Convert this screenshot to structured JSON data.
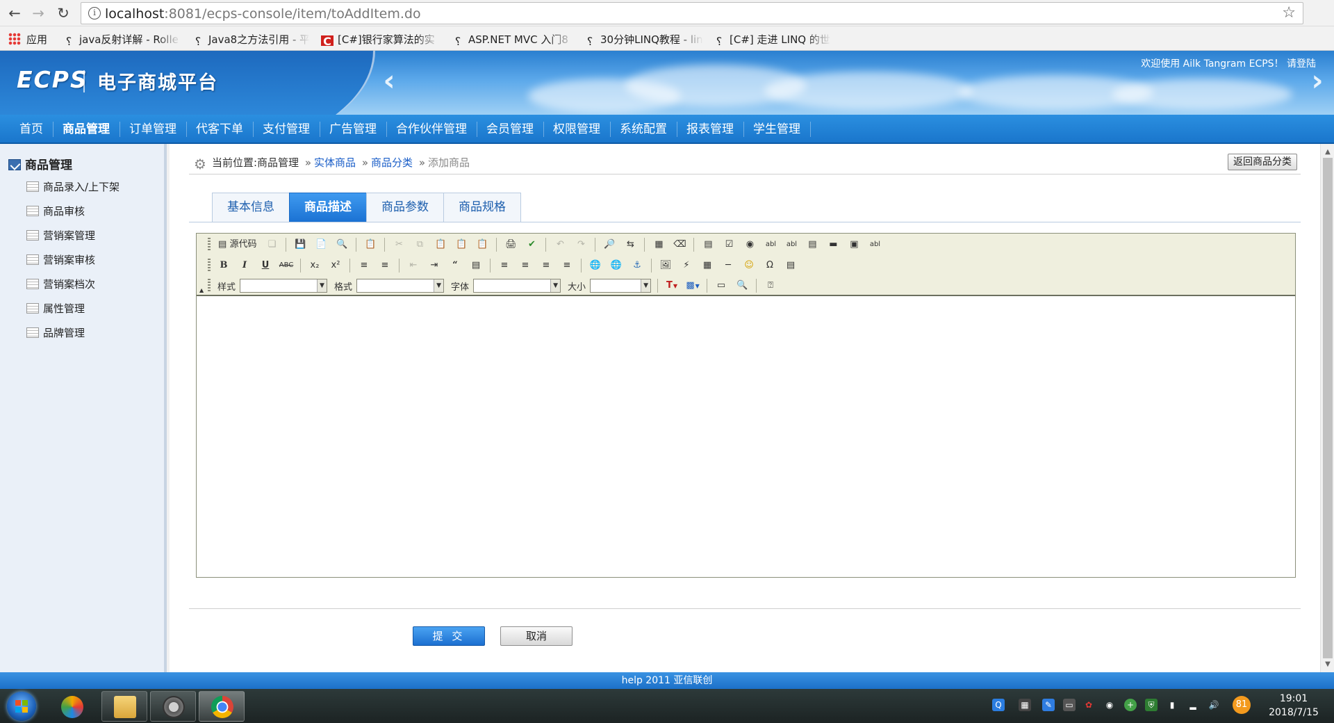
{
  "browser": {
    "url_host": "localhost",
    "url_rest": ":8081/ecps-console/item/toAddItem.do",
    "apps_label": "应用",
    "bookmarks": [
      {
        "label": "java反射详解 - Rolle",
        "icon": "bookmark-icon"
      },
      {
        "label": "Java8之方法引用 - 平",
        "icon": "bookmark-icon"
      },
      {
        "label": "[C#]银行家算法的实",
        "icon": "csdn-icon"
      },
      {
        "label": "ASP.NET MVC 入门8",
        "icon": "bookmark-icon"
      },
      {
        "label": "30分钟LINQ教程 - lin",
        "icon": "bookmark-icon"
      },
      {
        "label": "[C#] 走进 LINQ 的世",
        "icon": "bookmark-icon"
      }
    ]
  },
  "header": {
    "logo_en": "ECPS",
    "logo_cn": "电子商城平台",
    "welcome": "欢迎使用 Ailk Tangram ECPS！ 请登陆"
  },
  "nav": {
    "items": [
      "首页",
      "商品管理",
      "订单管理",
      "代客下单",
      "支付管理",
      "广告管理",
      "合作伙伴管理",
      "会员管理",
      "权限管理",
      "系统配置",
      "报表管理",
      "学生管理"
    ],
    "active_index": 1
  },
  "sidebar": {
    "title": "商品管理",
    "items": [
      "商品录入/上下架",
      "商品审核",
      "营销案管理",
      "营销案审核",
      "营销案档次",
      "属性管理",
      "品牌管理"
    ]
  },
  "breadcrumb": {
    "prefix": "当前位置:商品管理",
    "links": [
      "实体商品",
      "商品分类"
    ],
    "current": "添加商品",
    "separator": "»"
  },
  "back_button": "返回商品分类",
  "tabs": {
    "items": [
      "基本信息",
      "商品描述",
      "商品参数",
      "商品规格"
    ],
    "active_index": 1
  },
  "editor": {
    "source_label": "源代码",
    "style_label": "样式",
    "format_label": "格式",
    "font_label": "字体",
    "size_label": "大小",
    "style_value": "",
    "format_value": "",
    "font_value": "",
    "size_value": ""
  },
  "form": {
    "submit": "提 交",
    "cancel": "取消"
  },
  "footer": "help 2011 亚信联创",
  "taskbar": {
    "time": "19:01",
    "date": "2018/7/15",
    "badge": "81"
  },
  "colors": {
    "primary_blue": "#1a76cc",
    "link_blue": "#1a5ec8",
    "toolbar_bg": "#efefde"
  }
}
